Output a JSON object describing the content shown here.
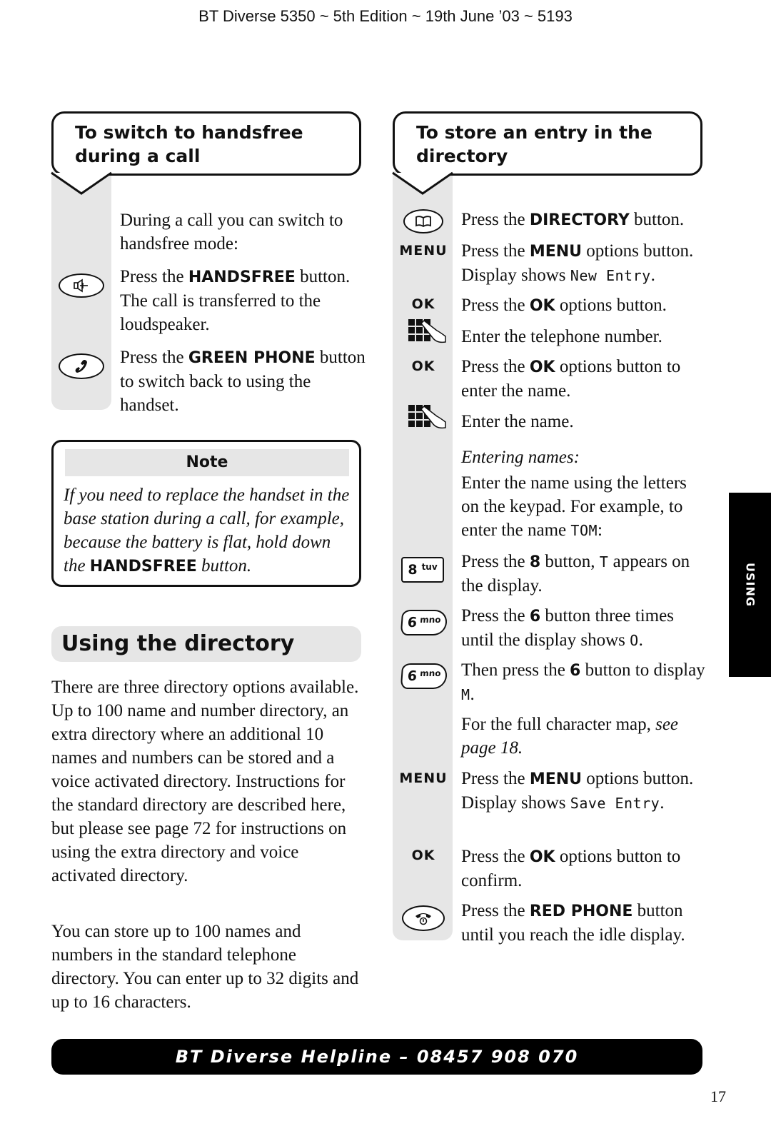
{
  "header": {
    "running_title": "BT Diverse 5350 ~ 5th Edition ~ 19th June ’03 ~ 5193"
  },
  "handsfree": {
    "heading": "To switch to handsfree during a call",
    "intro": "During a call you can switch to handsfree mode:",
    "steps": [
      {
        "icon": "handsfree-button-icon",
        "pre": "Press the ",
        "key": "HANDSFREE",
        "post": " button. The call is transferred to the loudspeaker."
      },
      {
        "icon": "green-phone-button-icon",
        "pre": "Press the ",
        "key": "GREEN PHONE",
        "post": " button to switch back to using the handset."
      }
    ]
  },
  "note": {
    "title": "Note",
    "body_pre": "If you need to replace the handset in the base station during a call, for example, because the battery is flat, hold down the ",
    "body_key": "HANDSFREE",
    "body_post": " button."
  },
  "directory_section": {
    "heading": "Using the directory",
    "paragraphs": [
      "There are three directory options available. Up to 100 name and number directory, an extra directory where an additional 10 names and numbers can be stored and a voice activated directory. Instructions for the standard directory are described here, but please see page 72 for instructions on using the extra directory and voice activated directory.",
      "You can store up to 100 names and numbers in the standard telephone directory. You can enter up to 32 digits and up to 16 characters."
    ]
  },
  "store_entry": {
    "heading": "To store an entry in the directory",
    "icon_labels": {
      "menu": "MENU",
      "ok": "OK",
      "key8_digit": "8",
      "key8_letters": "tuv",
      "key6_digit": "6",
      "key6_letters": "mno"
    },
    "steps": [
      {
        "pre": "Press the ",
        "key": "DIRECTORY",
        "post": " button."
      },
      {
        "pre": "Press the ",
        "key": "MENU",
        "post": " options button. Display shows ",
        "lcd": "New Entry",
        "end": "."
      },
      {
        "pre": "Press the ",
        "key": "OK",
        "post": " options button."
      },
      {
        "text": "Enter the telephone number."
      },
      {
        "pre": "Press the ",
        "key": "OK",
        "post": " options button to enter the name."
      },
      {
        "text": "Enter the name."
      },
      {
        "subheading": "Entering names:",
        "pre": "Enter the name using the letters on the keypad. For example, to enter the name ",
        "lcd": "TOM",
        "end": ":"
      },
      {
        "pre": "Press the ",
        "key": "8",
        "post": " button, ",
        "lcd": "T",
        "end": " appears on the display."
      },
      {
        "pre": "Press the ",
        "key": "6",
        "post": " button three times until the display shows ",
        "lcd": "O",
        "end": "."
      },
      {
        "pre": "Then press the ",
        "key": "6",
        "post": " button to display ",
        "lcd": "M",
        "end": "."
      },
      {
        "pre": "For the full character map, ",
        "italic": "see page 18."
      },
      {
        "pre": "Press the ",
        "key": "MENU",
        "post": " options button. Display shows ",
        "lcd": "Save Entry",
        "end": "."
      },
      {
        "pre": "Press the ",
        "key": "OK",
        "post": " options button to confirm."
      },
      {
        "pre": "Press the ",
        "key": "RED PHONE",
        "post": " button until you reach the idle display."
      }
    ]
  },
  "side_tab": {
    "label": "USING"
  },
  "footer": {
    "helpline": "BT Diverse Helpline – 08457 908 070",
    "page_number": "17"
  }
}
